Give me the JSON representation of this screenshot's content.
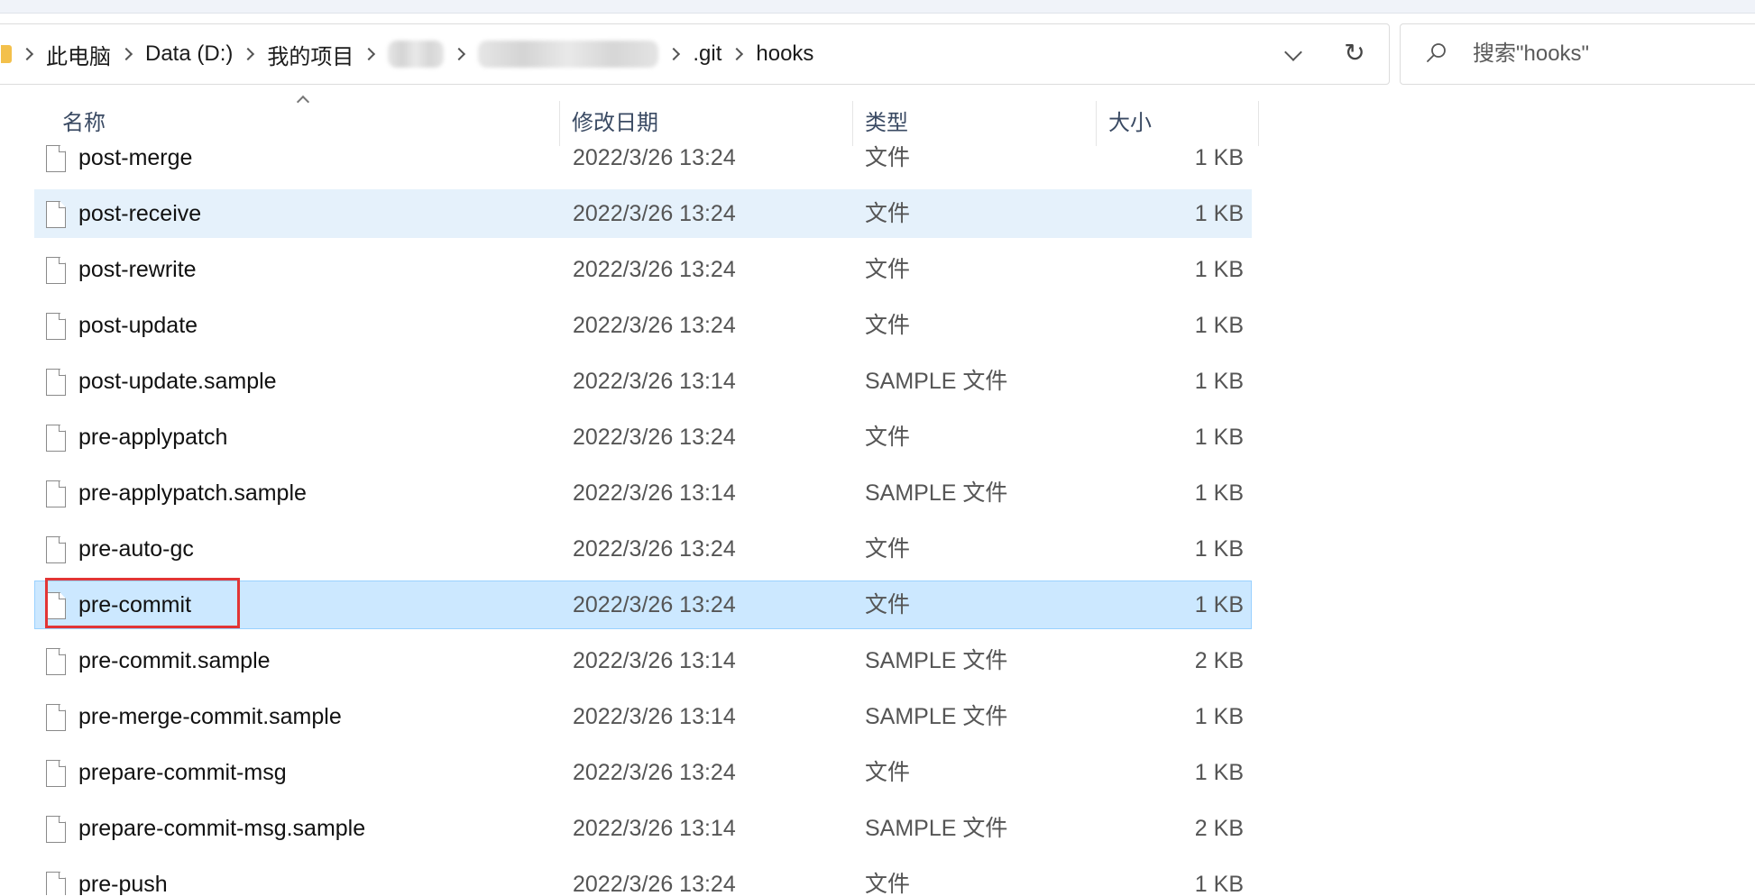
{
  "breadcrumb": {
    "items": [
      {
        "label": "此电脑"
      },
      {
        "label": "Data (D:)"
      },
      {
        "label": "我的项目"
      },
      {
        "label": ""
      },
      {
        "label": ""
      },
      {
        "label": ".git"
      },
      {
        "label": "hooks"
      }
    ]
  },
  "search": {
    "placeholder": "搜索\"hooks\""
  },
  "columns": {
    "name": "名称",
    "date": "修改日期",
    "type": "类型",
    "size": "大小"
  },
  "files": [
    {
      "name": "post-merge",
      "date": "2022/3/26 13:24",
      "type": "文件",
      "size": "1 KB"
    },
    {
      "name": "post-receive",
      "date": "2022/3/26 13:24",
      "type": "文件",
      "size": "1 KB"
    },
    {
      "name": "post-rewrite",
      "date": "2022/3/26 13:24",
      "type": "文件",
      "size": "1 KB"
    },
    {
      "name": "post-update",
      "date": "2022/3/26 13:24",
      "type": "文件",
      "size": "1 KB"
    },
    {
      "name": "post-update.sample",
      "date": "2022/3/26 13:14",
      "type": "SAMPLE 文件",
      "size": "1 KB"
    },
    {
      "name": "pre-applypatch",
      "date": "2022/3/26 13:24",
      "type": "文件",
      "size": "1 KB"
    },
    {
      "name": "pre-applypatch.sample",
      "date": "2022/3/26 13:14",
      "type": "SAMPLE 文件",
      "size": "1 KB"
    },
    {
      "name": "pre-auto-gc",
      "date": "2022/3/26 13:24",
      "type": "文件",
      "size": "1 KB"
    },
    {
      "name": "pre-commit",
      "date": "2022/3/26 13:24",
      "type": "文件",
      "size": "1 KB"
    },
    {
      "name": "pre-commit.sample",
      "date": "2022/3/26 13:14",
      "type": "SAMPLE 文件",
      "size": "2 KB"
    },
    {
      "name": "pre-merge-commit.sample",
      "date": "2022/3/26 13:14",
      "type": "SAMPLE 文件",
      "size": "1 KB"
    },
    {
      "name": "prepare-commit-msg",
      "date": "2022/3/26 13:24",
      "type": "文件",
      "size": "1 KB"
    },
    {
      "name": "prepare-commit-msg.sample",
      "date": "2022/3/26 13:14",
      "type": "SAMPLE 文件",
      "size": "2 KB"
    },
    {
      "name": "pre-push",
      "date": "2022/3/26 13:24",
      "type": "文件",
      "size": "1 KB"
    }
  ],
  "colors": {
    "selected_bg": "#cce8ff",
    "hover_bg": "#e5f1fb",
    "annotation": "#e23535"
  }
}
